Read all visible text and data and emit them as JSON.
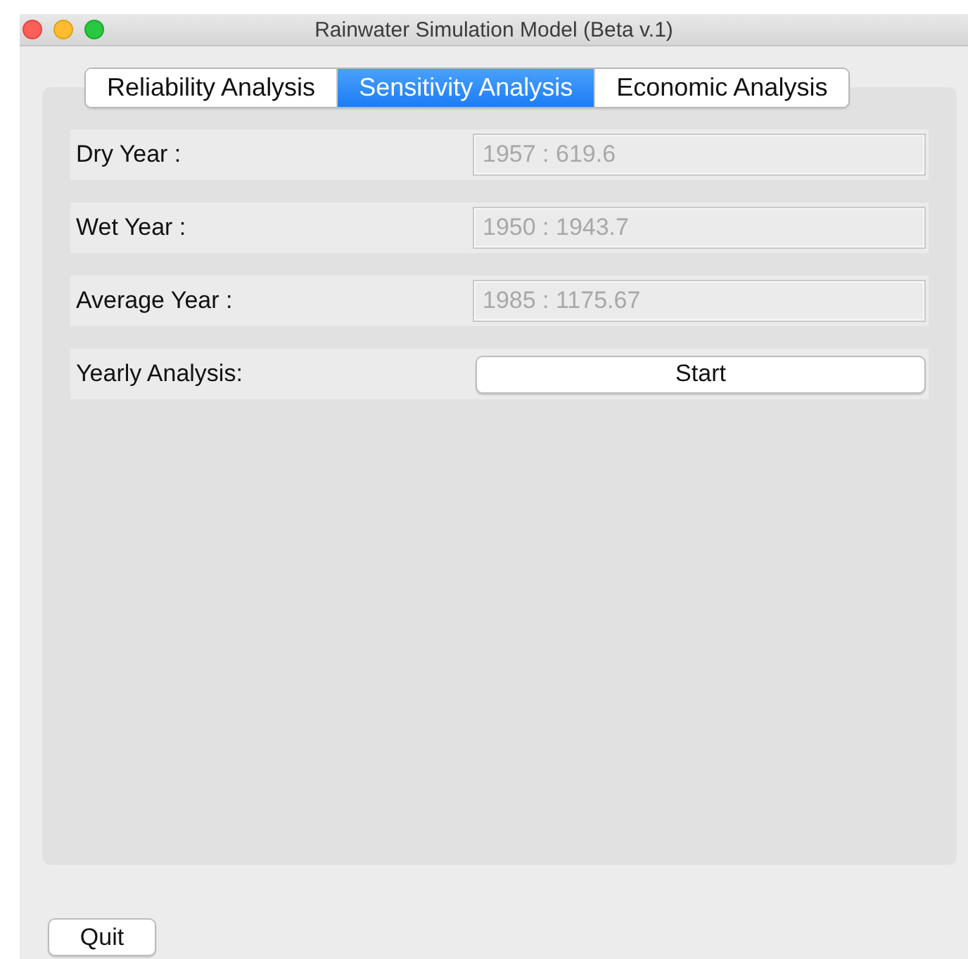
{
  "window": {
    "title": "Rainwater Simulation Model (Beta v.1)"
  },
  "tabs": [
    {
      "label": "Reliability Analysis",
      "selected": false
    },
    {
      "label": "Sensitivity Analysis",
      "selected": true
    },
    {
      "label": "Economic Analysis",
      "selected": false
    }
  ],
  "rows": [
    {
      "kind": "field",
      "label": "Dry Year :",
      "value": "1957 : 619.6",
      "disabled": true
    },
    {
      "kind": "field",
      "label": "Wet Year :",
      "value": "1950 : 1943.7",
      "disabled": true
    },
    {
      "kind": "field",
      "label": "Average Year :",
      "value": "1985 : 1175.67",
      "disabled": true
    },
    {
      "kind": "button",
      "label": "Yearly Analysis:",
      "button": "Start"
    }
  ],
  "quit_button": "Quit"
}
